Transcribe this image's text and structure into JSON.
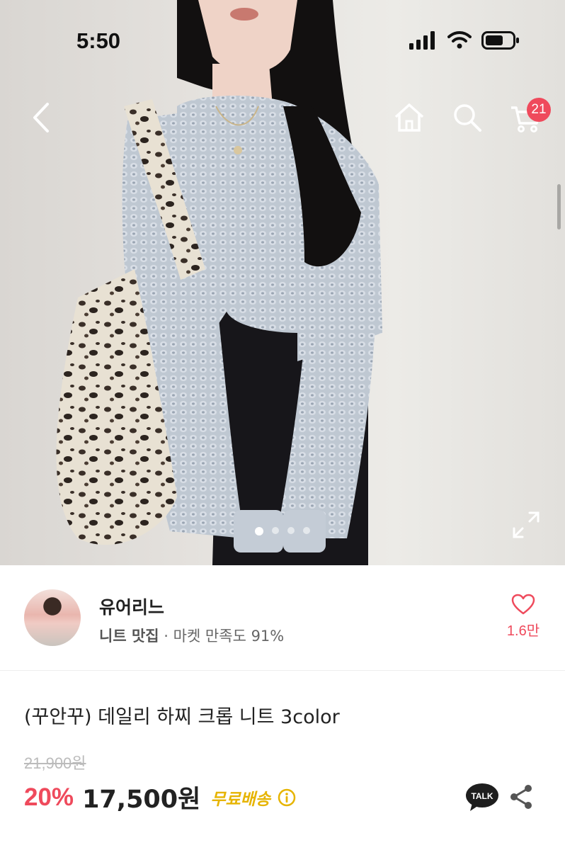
{
  "status_bar": {
    "time": "5:50",
    "icons": [
      "signal-icon",
      "wifi-icon",
      "battery-icon"
    ]
  },
  "nav": {
    "icons": [
      "back-icon",
      "home-icon",
      "search-icon",
      "cart-icon"
    ],
    "cart_count": "21"
  },
  "gallery": {
    "image": "product-photo: model wearing light blue chunky knit cropped sweater with leopard-print tote bag",
    "dot_count": 4,
    "active_index": 0,
    "icons": [
      "expand-icon"
    ]
  },
  "seller": {
    "name": "유어리느",
    "tag": "니트 맛집",
    "satisfaction": " · 마켓 만족도 91%",
    "likes": "1.6만",
    "icons": [
      "heart-icon"
    ]
  },
  "product": {
    "title": "(꾸안꾸) 데일리 하찌 크롭 니트 3color",
    "original_price": "21,900원",
    "discount": "20%",
    "price": "17,500원",
    "shipping": "무료배송",
    "talk_label": "TALK",
    "icons": [
      "info-icon",
      "talk-icon",
      "share-icon"
    ]
  },
  "colors": {
    "accent": "#ef4a5c",
    "shipping": "#e6b400",
    "talk_bubble": "#1e1e1e"
  }
}
